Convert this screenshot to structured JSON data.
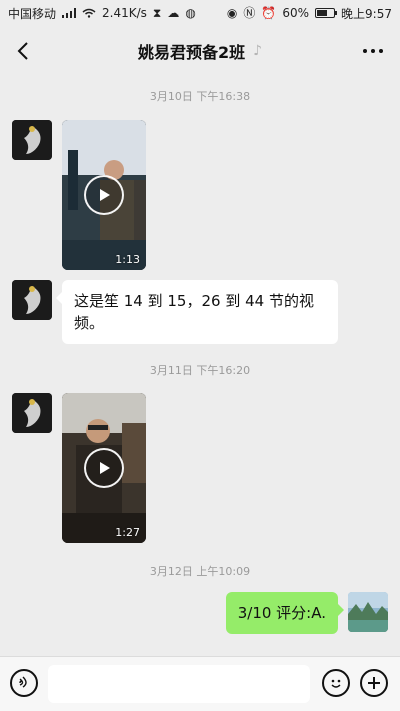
{
  "status_bar": {
    "carrier": "中国移动",
    "net_speed": "2.41K/s",
    "battery": "60%",
    "battery_level": 0.6,
    "time": "晚上9:57",
    "icons": [
      "signal-icon",
      "wifi-icon",
      "hourglass-icon",
      "message-icon",
      "browser-icon",
      "eye-icon",
      "nfc-icon",
      "alarm-icon",
      "battery-icon"
    ]
  },
  "header": {
    "title": "姚易君预备2班",
    "back_icon": "chevron-left-icon",
    "mute_icon": "ear-icon",
    "more_icon": "more-icon"
  },
  "messages": [
    {
      "kind": "timestamp",
      "text": "3月10日 下午16:38"
    },
    {
      "kind": "video",
      "sender": "other",
      "duration": "1:13"
    },
    {
      "kind": "text",
      "sender": "other",
      "text": "这是笙 14 到 15，26 到 44 节的视频。"
    },
    {
      "kind": "timestamp",
      "text": "3月11日 下午16:20"
    },
    {
      "kind": "video",
      "sender": "other",
      "duration": "1:27"
    },
    {
      "kind": "timestamp",
      "text": "3月12日 上午10:09"
    },
    {
      "kind": "text",
      "sender": "me",
      "text": "3/10 评分:A."
    }
  ],
  "input_bar": {
    "voice_icon": "voice-icon",
    "input_placeholder": "",
    "emoji_icon": "emoji-icon",
    "plus_icon": "plus-icon"
  },
  "colors": {
    "background": "#ededed",
    "my_bubble": "#95ec69",
    "other_bubble": "#ffffff"
  }
}
